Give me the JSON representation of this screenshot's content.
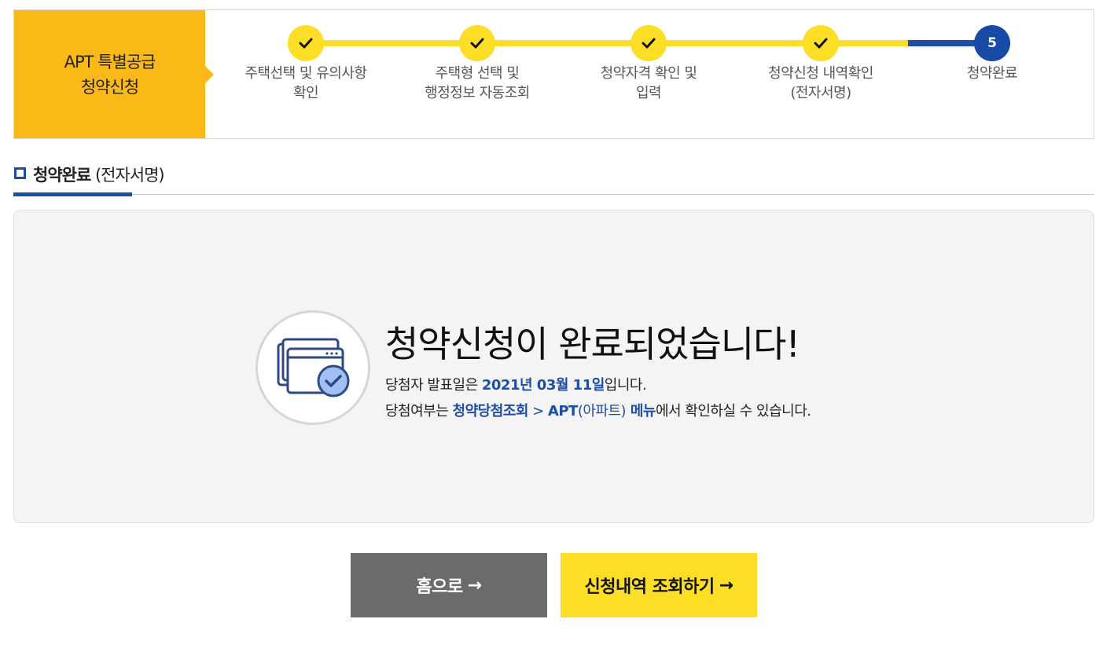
{
  "stepper": {
    "title_line1": "APT 특별공급",
    "title_line2": "청약신청",
    "steps": [
      {
        "status": "done",
        "line1": "주택선택 및 유의사항",
        "line2": "확인"
      },
      {
        "status": "done",
        "line1": "주택형 선택 및",
        "line2": "행정정보 자동조회"
      },
      {
        "status": "done",
        "line1": "청약자격 확인 및",
        "line2": "입력"
      },
      {
        "status": "done",
        "line1": "청약신청 내역확인",
        "line2": "(전자서명)"
      },
      {
        "status": "current",
        "number": "5",
        "line1": "청약완료",
        "line2": ""
      }
    ]
  },
  "section": {
    "title_bold": "청약완료",
    "title_light": " (전자서명)"
  },
  "completion": {
    "icon": "browser-windows-check-icon",
    "title": "청약신청이 완료되었습니다!",
    "line1_prefix": "당첨자 발표일은 ",
    "line1_date": "2021년 03월 11일",
    "line1_suffix": "입니다.",
    "line2_prefix": "당첨여부는 ",
    "line2_menu1": "청약당첨조회",
    "line2_sep": " > ",
    "line2_menu2_a": "APT",
    "line2_menu2_b": "(아파트)",
    "line2_menu2_c": " 메뉴",
    "line2_suffix": "에서 확인하실 수 있습니다."
  },
  "buttons": {
    "home_label": "홈으로",
    "history_label": "신청내역 조회하기",
    "arrow": "→"
  },
  "colors": {
    "stepper_title_bg": "#fbb917",
    "done_yellow": "#fdde26",
    "accent_blue": "#1d4ea6",
    "home_button_bg": "#6b6b6b"
  }
}
